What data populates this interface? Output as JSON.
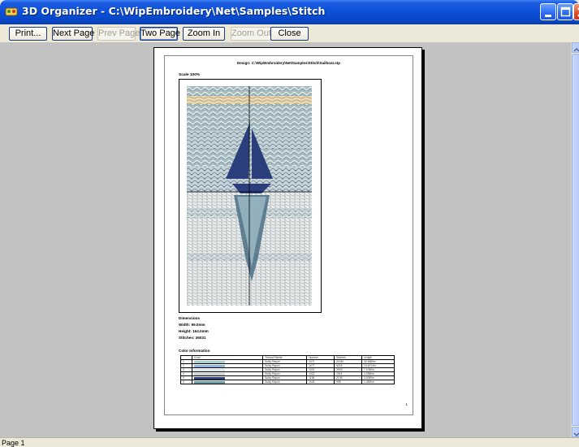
{
  "window": {
    "title": "3D Organizer - C:\\WipEmbroidery\\Net\\Samples\\Stitch",
    "icons": [
      "app-icon",
      "minimize-icon",
      "maximize-icon",
      "close-icon"
    ]
  },
  "toolbar": {
    "buttons": [
      {
        "label": "Print...",
        "enabled": true
      },
      {
        "label": "Next Page",
        "enabled": true
      },
      {
        "label": "Prev Page",
        "enabled": false
      },
      {
        "label": "Two Page",
        "enabled": true
      },
      {
        "label": "Zoom In",
        "enabled": true
      },
      {
        "label": "Zoom Out",
        "enabled": false
      },
      {
        "label": "Close",
        "enabled": true
      }
    ]
  },
  "preview": {
    "design_header": "Design: C:\\Wip\\Embroidery\\Net\\Samples\\Stitch\\Sailboat.stp",
    "scale": "Scale  100%",
    "dimensions": {
      "heading": "Dimensions",
      "width": "Width: 99.0mm",
      "height": "Height: 164.0mm",
      "stitches": "Stitches: 36031"
    },
    "color_heading": "Color Information",
    "color_table": {
      "headers": [
        "",
        "Color",
        "Thread Palette",
        "Number",
        "Stitches",
        "Length"
      ],
      "rows": [
        {
          "num": "1",
          "color": "#a8d2d0",
          "palette": "Sulky Rayon",
          "number": "1071",
          "stitches": "21160",
          "length": "32.4889m"
        },
        {
          "num": "2",
          "color": "#8fb8e0",
          "palette": "Sulky Rayon",
          "number": "1077",
          "stitches": "6218",
          "length": "10.4214m"
        },
        {
          "num": "3",
          "color": "#dfe6ea",
          "palette": "Sulky Rayon",
          "number": "1001",
          "stitches": "3903",
          "length": "7.1050m"
        },
        {
          "num": "4",
          "color": "#c9d3da",
          "palette": "Sulky Rayon",
          "number": "1022",
          "stitches": "1514",
          "length": "4.3950m"
        },
        {
          "num": "5",
          "color": "#2b3f7c",
          "palette": "Sulky Rayon",
          "number": "1196",
          "stitches": "2138",
          "length": "3.3050m"
        },
        {
          "num": "6",
          "color": "#6aa0a3",
          "palette": "Sulky Rayon",
          "number": "1046",
          "stitches": "998",
          "length": "1.4890m"
        }
      ]
    },
    "page_number": "1"
  },
  "status": {
    "text": "Page 1"
  },
  "colors": {
    "titlebar": "#0a4fd6",
    "workspace": "#c2c2c2",
    "boat": "#2b3f7c"
  }
}
